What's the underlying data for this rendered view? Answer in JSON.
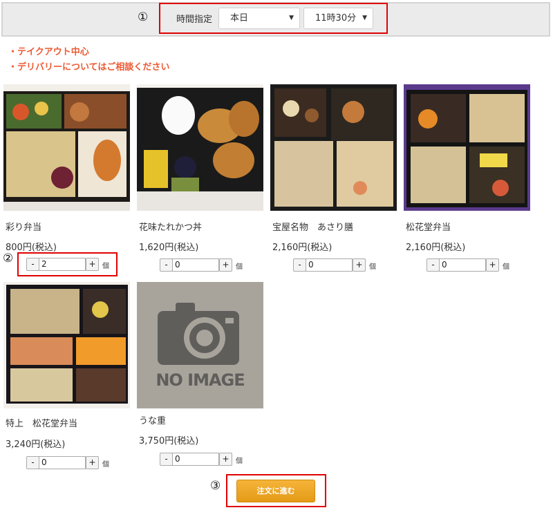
{
  "time": {
    "label": "時間指定",
    "day_value": "本日",
    "time_value": "11時30分"
  },
  "markers": {
    "m1": "①",
    "m2": "②",
    "m3": "③"
  },
  "notes": [
    "・テイクアウト中心",
    "・デリバリーについてはご相談ください"
  ],
  "products": [
    {
      "name": "彩り弁当",
      "price": "800円(税込)",
      "qty": "2"
    },
    {
      "name": "花味たれかつ丼",
      "price": "1,620円(税込)",
      "qty": "0"
    },
    {
      "name": "宝屋名物　あさり膳",
      "price": "2,160円(税込)",
      "qty": "0"
    },
    {
      "name": "松花堂弁当",
      "price": "2,160円(税込)",
      "qty": "0"
    },
    {
      "name": "特上　松花堂弁当",
      "price": "3,240円(税込)",
      "qty": "0"
    },
    {
      "name": "うな重",
      "price": "3,750円(税込)",
      "qty": "0",
      "image_text": "NO IMAGE"
    }
  ],
  "qty_labels": {
    "minus": "-",
    "plus": "+",
    "unit": "個"
  },
  "order_button": "注文に進む",
  "colors": {
    "accent_red": "#e00000",
    "note_orange": "#ec5a34",
    "button_orange": "#eda226"
  }
}
